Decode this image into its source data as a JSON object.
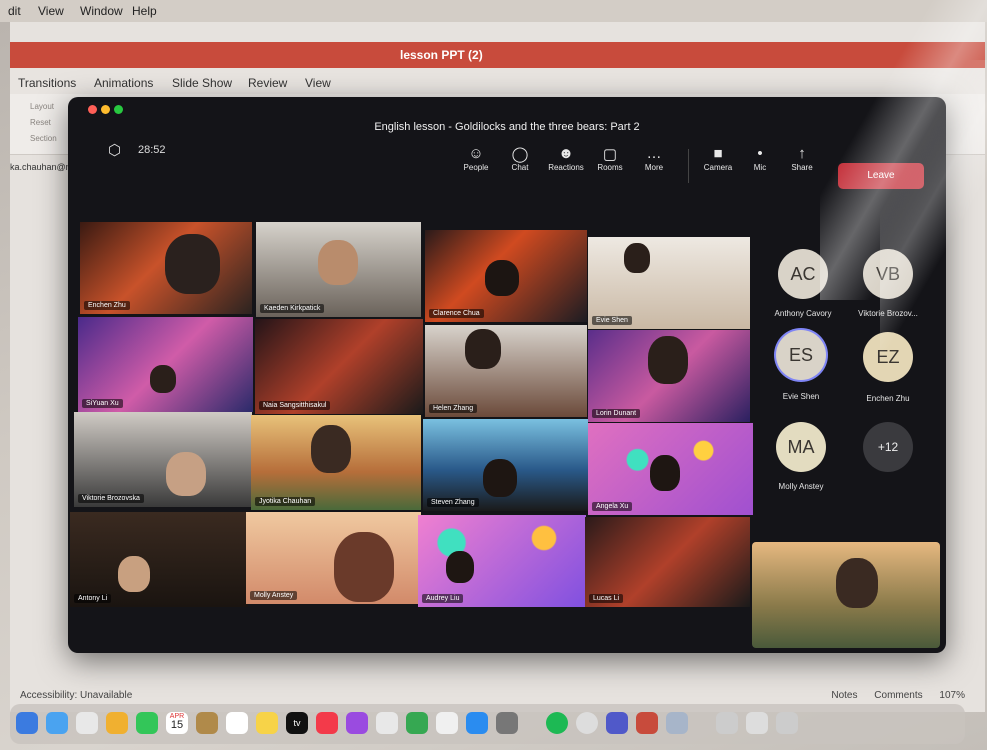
{
  "menubar": {
    "items": [
      "dit",
      "View",
      "Window",
      "Help"
    ]
  },
  "ppt": {
    "title": "lesson PPT (2)",
    "tabs": [
      "Transitions",
      "Animations",
      "Slide Show",
      "Review",
      "View"
    ],
    "ribbon_items": [
      "Layout",
      "Reset",
      "Section"
    ],
    "email": "ka.chauhan@nbi",
    "status_accessibility": "Accessibility: Unavailable",
    "status_notes": "Notes",
    "status_comments": "Comments",
    "zoom": "107%"
  },
  "meeting": {
    "title": "English lesson - Goldilocks and the three bears: Part 2",
    "timer": "28:52",
    "controls": [
      "People",
      "Chat",
      "Reactions",
      "Rooms",
      "More"
    ],
    "media": [
      "Camera",
      "Mic",
      "Share"
    ],
    "leave_label": "Leave",
    "participants": [
      "Enchen Zhu",
      "Kaeden Kirkpatick",
      "Clarence Chua",
      "Evie Shen",
      "SiYuan Xu",
      "Naia Sangsitthisakul",
      "Helen Zhang",
      "Lorin Dunant",
      "Viktorie Brozovska",
      "Jyotika Chauhan",
      "Steven Zhang",
      "Angela Xu",
      "Antony Li",
      "Molly Anstey",
      "Audrey Liu",
      "Lucas Li"
    ],
    "roster": [
      {
        "initials": "AC",
        "name": "Anthony Cavory"
      },
      {
        "initials": "VB",
        "name": "Viktorie Brozov..."
      },
      {
        "initials": "ES",
        "name": "Evie Shen"
      },
      {
        "initials": "EZ",
        "name": "Enchen Zhu"
      },
      {
        "initials": "MA",
        "name": "Molly Anstey"
      },
      {
        "initials": "+12",
        "name": ""
      }
    ]
  },
  "dock": {
    "calendar_day": "15",
    "calendar_month": "APR",
    "tv": "tv"
  },
  "colors": {
    "teams_bg": "#141418",
    "leave": "#c4313b",
    "ppt_red": "#c84b3c",
    "avatar": "#d9d3c8"
  }
}
